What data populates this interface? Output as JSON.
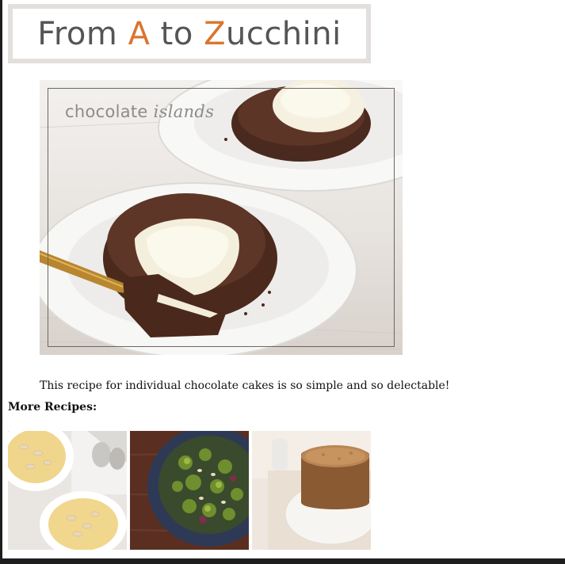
{
  "site": {
    "title_parts": {
      "part1": "From ",
      "accent1": "A",
      "part2": " to ",
      "accent2": "Z",
      "part3": "ucchini"
    },
    "accent_color": "#d9762e",
    "title_color": "#555555"
  },
  "hero": {
    "label_regular": "chocolate ",
    "label_italic": "islands"
  },
  "description": "This recipe for individual chocolate cakes is so simple and so delectable!",
  "more_recipes": {
    "heading": "More Recipes:",
    "thumbnails": [
      {
        "icon": "almond-custard-bowls-image"
      },
      {
        "icon": "brussels-sprouts-pan-image"
      },
      {
        "icon": "round-cake-image"
      }
    ]
  }
}
